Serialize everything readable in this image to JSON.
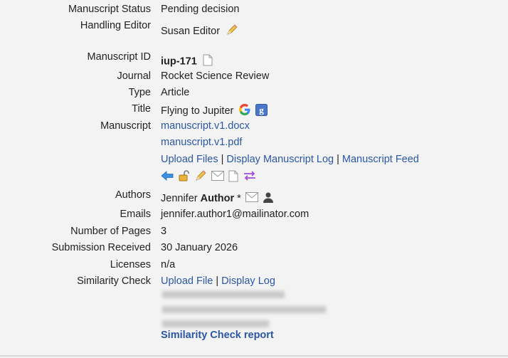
{
  "fields": {
    "status_label": "Manuscript Status",
    "status_value": "Pending decision",
    "editor_label": "Handling Editor",
    "editor_value": "Susan Editor",
    "id_label": "Manuscript ID",
    "id_value": "iup-171",
    "journal_label": "Journal",
    "journal_value": "Rocket Science Review",
    "type_label": "Type",
    "type_value": "Article",
    "title_label": "Title",
    "title_value": "Flying to Jupiter",
    "manuscript_label": "Manuscript",
    "file1": "manuscript.v1.docx",
    "file2": "manuscript.v1.pdf",
    "upload_files": "Upload Files",
    "display_log": "Display Manuscript Log",
    "feed": "Manuscript Feed",
    "authors_label": "Authors",
    "author_first": "Jennifer",
    "author_last": "Author",
    "author_mark": "*",
    "emails_label": "Emails",
    "emails_value": "jennifer.author1@mailinator.com",
    "pages_label": "Number of Pages",
    "pages_value": "3",
    "received_label": "Submission Received",
    "received_value": "30 January 2026",
    "licenses_label": "Licenses",
    "licenses_value": "n/a",
    "similarity_label": "Similarity Check",
    "sim_upload": "Upload File",
    "sim_display_log": "Display Log",
    "sim_report": "Similarity Check report"
  },
  "separators": {
    "pipe": "|"
  },
  "icons": {
    "edit": "pencil-icon",
    "doc": "document-icon",
    "google": "google-search-icon",
    "scholar": "google-scholar-icon",
    "back": "arrow-left-icon",
    "unlock": "unlock-icon",
    "mail": "mail-icon",
    "swap": "swap-arrows-icon",
    "person": "person-icon"
  },
  "colors": {
    "link": "#2a57a5",
    "background": "#f3f3f3"
  }
}
